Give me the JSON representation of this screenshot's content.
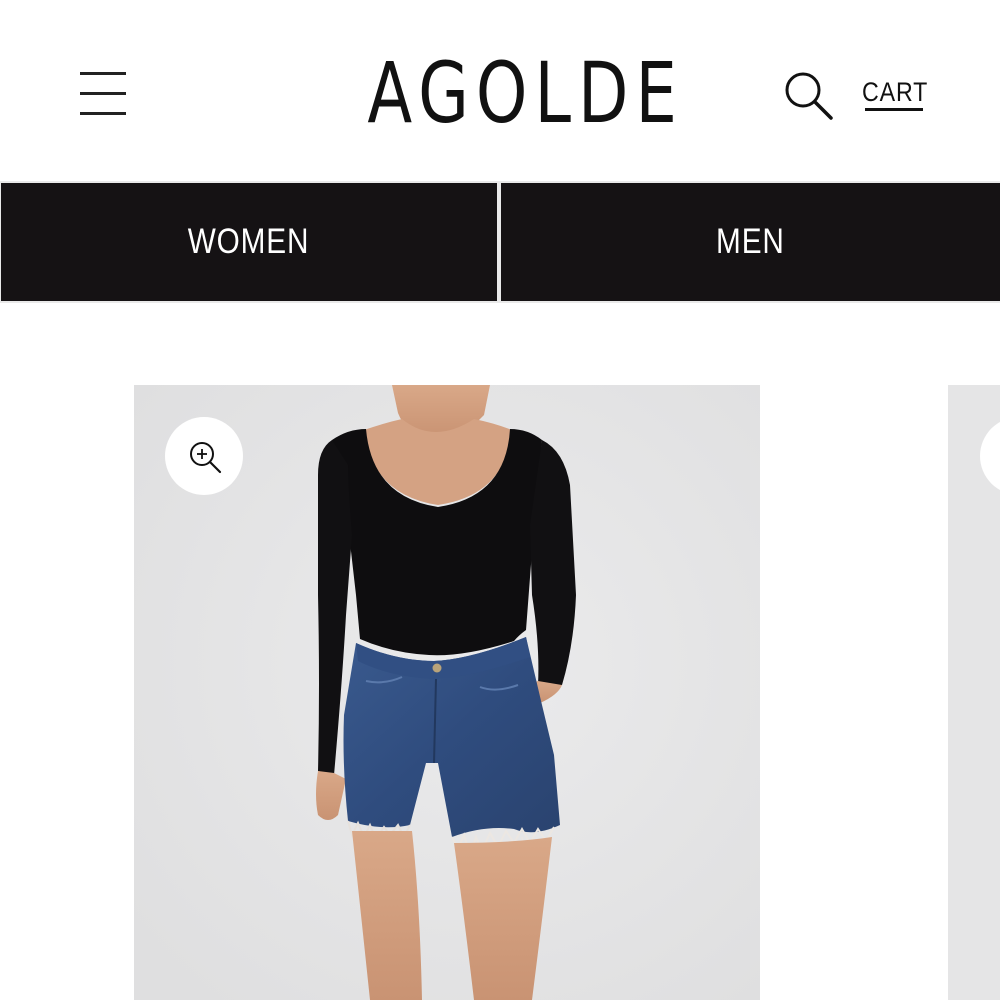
{
  "header": {
    "logo_text": "AGOLDE",
    "cart_label": "CART",
    "menu_icon": "hamburger-menu-icon",
    "search_icon": "search-icon"
  },
  "nav": {
    "tabs": [
      {
        "label": "WOMEN"
      },
      {
        "label": "MEN"
      }
    ]
  },
  "products": {
    "items": [
      {
        "zoom_icon": "zoom-in-icon",
        "image_description_icon": "product-photo"
      }
    ]
  },
  "colors": {
    "nav_background": "#151214",
    "nav_text": "#ffffff",
    "product_background": "#e6e6e7",
    "text": "#111111"
  }
}
